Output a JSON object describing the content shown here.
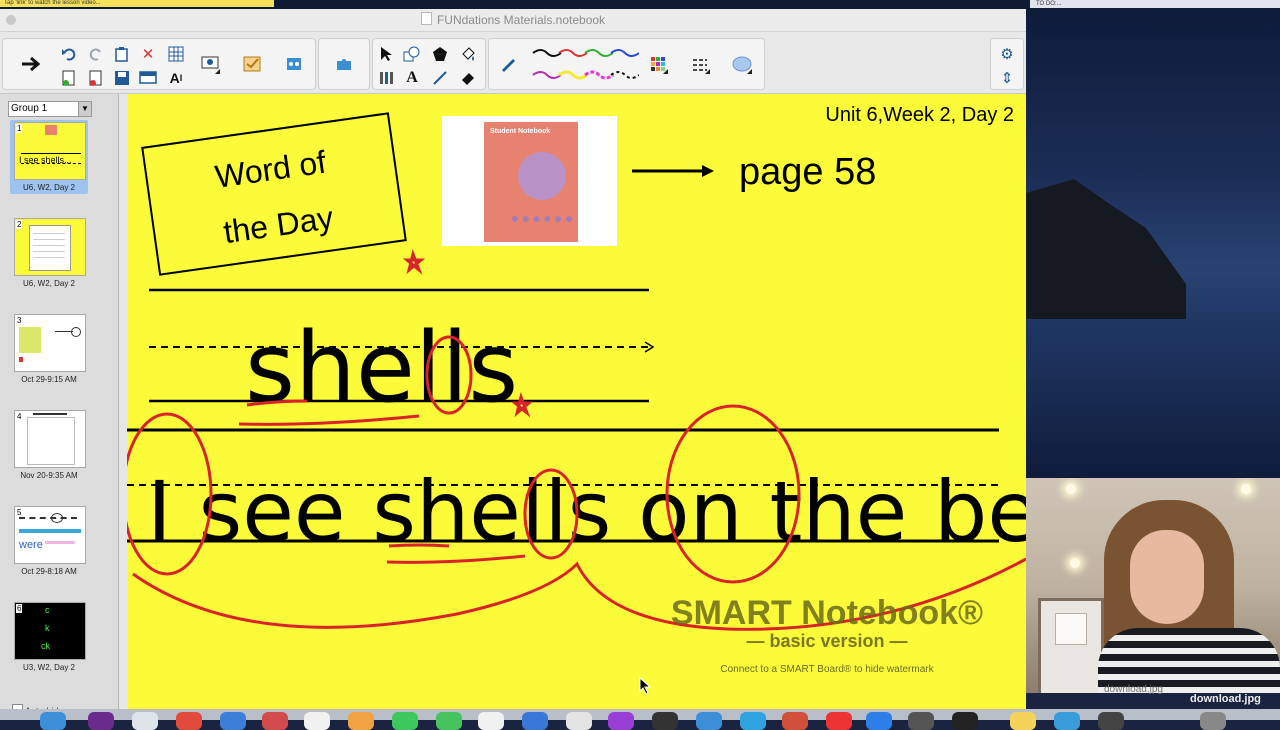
{
  "top_strip": {
    "note_text": "Tap 'link' to watch the lesson video...",
    "right_note": "TO DO:..."
  },
  "window": {
    "title": "FUNdations Materials.notebook"
  },
  "toolbar": {
    "groups": [
      {
        "name": "navigation",
        "buttons": [
          "arrow-right-icon",
          "undo-icon",
          "redo-icon",
          "paste-icon",
          "delete-icon",
          "table-icon",
          "new-page-icon",
          "screen-shade-icon",
          "save-icon",
          "full-screen-icon",
          "text-format-icon",
          "doc-camera-icon",
          "activity-icon",
          "add-on-icon",
          "measure-icon"
        ]
      },
      {
        "name": "tools",
        "buttons": [
          "select-icon",
          "shape-icon",
          "fill-icon",
          "eraser-pen-icon",
          "magic-pen-icon",
          "text-icon",
          "line-icon",
          "eraser-icon"
        ]
      },
      {
        "name": "pens",
        "pens": [
          "black",
          "red",
          "green",
          "purple",
          "violet",
          "yellow",
          "pink",
          "dash"
        ]
      },
      {
        "name": "properties",
        "buttons": [
          "settings-icon",
          "expand-icon"
        ]
      }
    ]
  },
  "sidebar": {
    "group_label": "Group 1",
    "autohide_label": "Auto-hide",
    "pages": [
      {
        "num": "1",
        "caption": "U6, W2, Day 2",
        "selected": true
      },
      {
        "num": "2",
        "caption": "U6, W2, Day 2",
        "selected": false
      },
      {
        "num": "3",
        "caption": "Oct 29-9:15 AM",
        "selected": false
      },
      {
        "num": "4",
        "caption": "Nov 20-9:35 AM",
        "selected": false
      },
      {
        "num": "5",
        "caption": "Oct 29-8:18 AM",
        "selected": false,
        "word": "were"
      },
      {
        "num": "6",
        "caption": "U3, W2, Day 2",
        "selected": false,
        "letters": [
          "c",
          "k",
          "ck"
        ]
      }
    ]
  },
  "canvas": {
    "unit_label": "Unit 6,Week 2, Day 2",
    "word_of_day_line1": "Word of",
    "word_of_day_line2": "the Day",
    "page_label": "page 58",
    "notebook_title": "Student Notebook",
    "word": "shells",
    "sentence": "I see shells on the beach.",
    "watermark_title": "SMART Notebook®",
    "watermark_sub": "— basic version —",
    "watermark_note": "Connect to a SMART Board® to hide watermark"
  },
  "webcam": {
    "label": "download.jpg"
  },
  "colors": {
    "canvas_bg": "#fbfb3a",
    "ink_red": "#d8232a",
    "ink_black": "#000000",
    "toolbar_icon": "#1f5a99"
  }
}
